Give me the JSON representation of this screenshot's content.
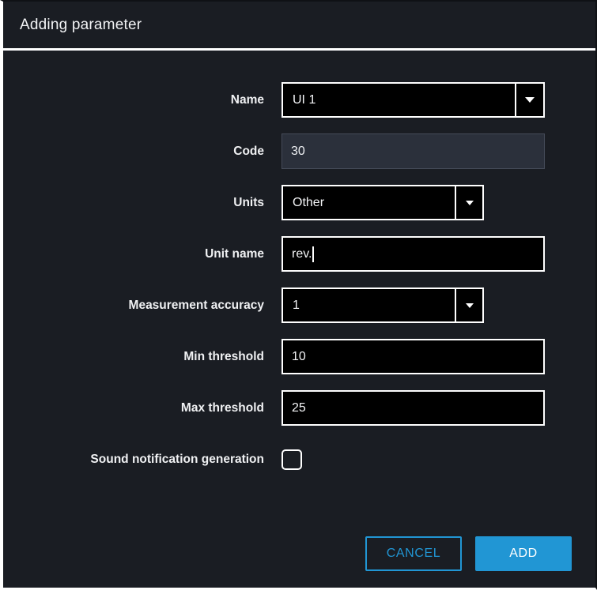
{
  "dialog": {
    "title": "Adding parameter",
    "accent_color": "#2196d4",
    "background_color": "#1a1d23",
    "input_background": "#000000",
    "disabled_input_background": "#2b303b",
    "border_color": "#ffffff"
  },
  "form": {
    "name": {
      "label": "Name",
      "value": "UI 1",
      "control": "combobox",
      "arrow_icon": "chevron-down-icon"
    },
    "code": {
      "label": "Code",
      "value": "30",
      "control": "text-readonly"
    },
    "units": {
      "label": "Units",
      "value": "Other",
      "control": "combobox",
      "arrow_icon": "chevron-down-icon"
    },
    "unit_name": {
      "label": "Unit name",
      "value": "rev.",
      "control": "text",
      "focused": "true"
    },
    "measurement_accuracy": {
      "label": "Measurement accuracy",
      "value": "1",
      "control": "combobox",
      "arrow_icon": "chevron-down-icon"
    },
    "min_threshold": {
      "label": "Min threshold",
      "value": "10",
      "control": "text"
    },
    "max_threshold": {
      "label": "Max threshold",
      "value": "25",
      "control": "text"
    },
    "sound_notification": {
      "label": "Sound notification generation",
      "checked": "false",
      "control": "checkbox"
    }
  },
  "footer": {
    "cancel_label": "CANCEL",
    "add_label": "ADD"
  }
}
